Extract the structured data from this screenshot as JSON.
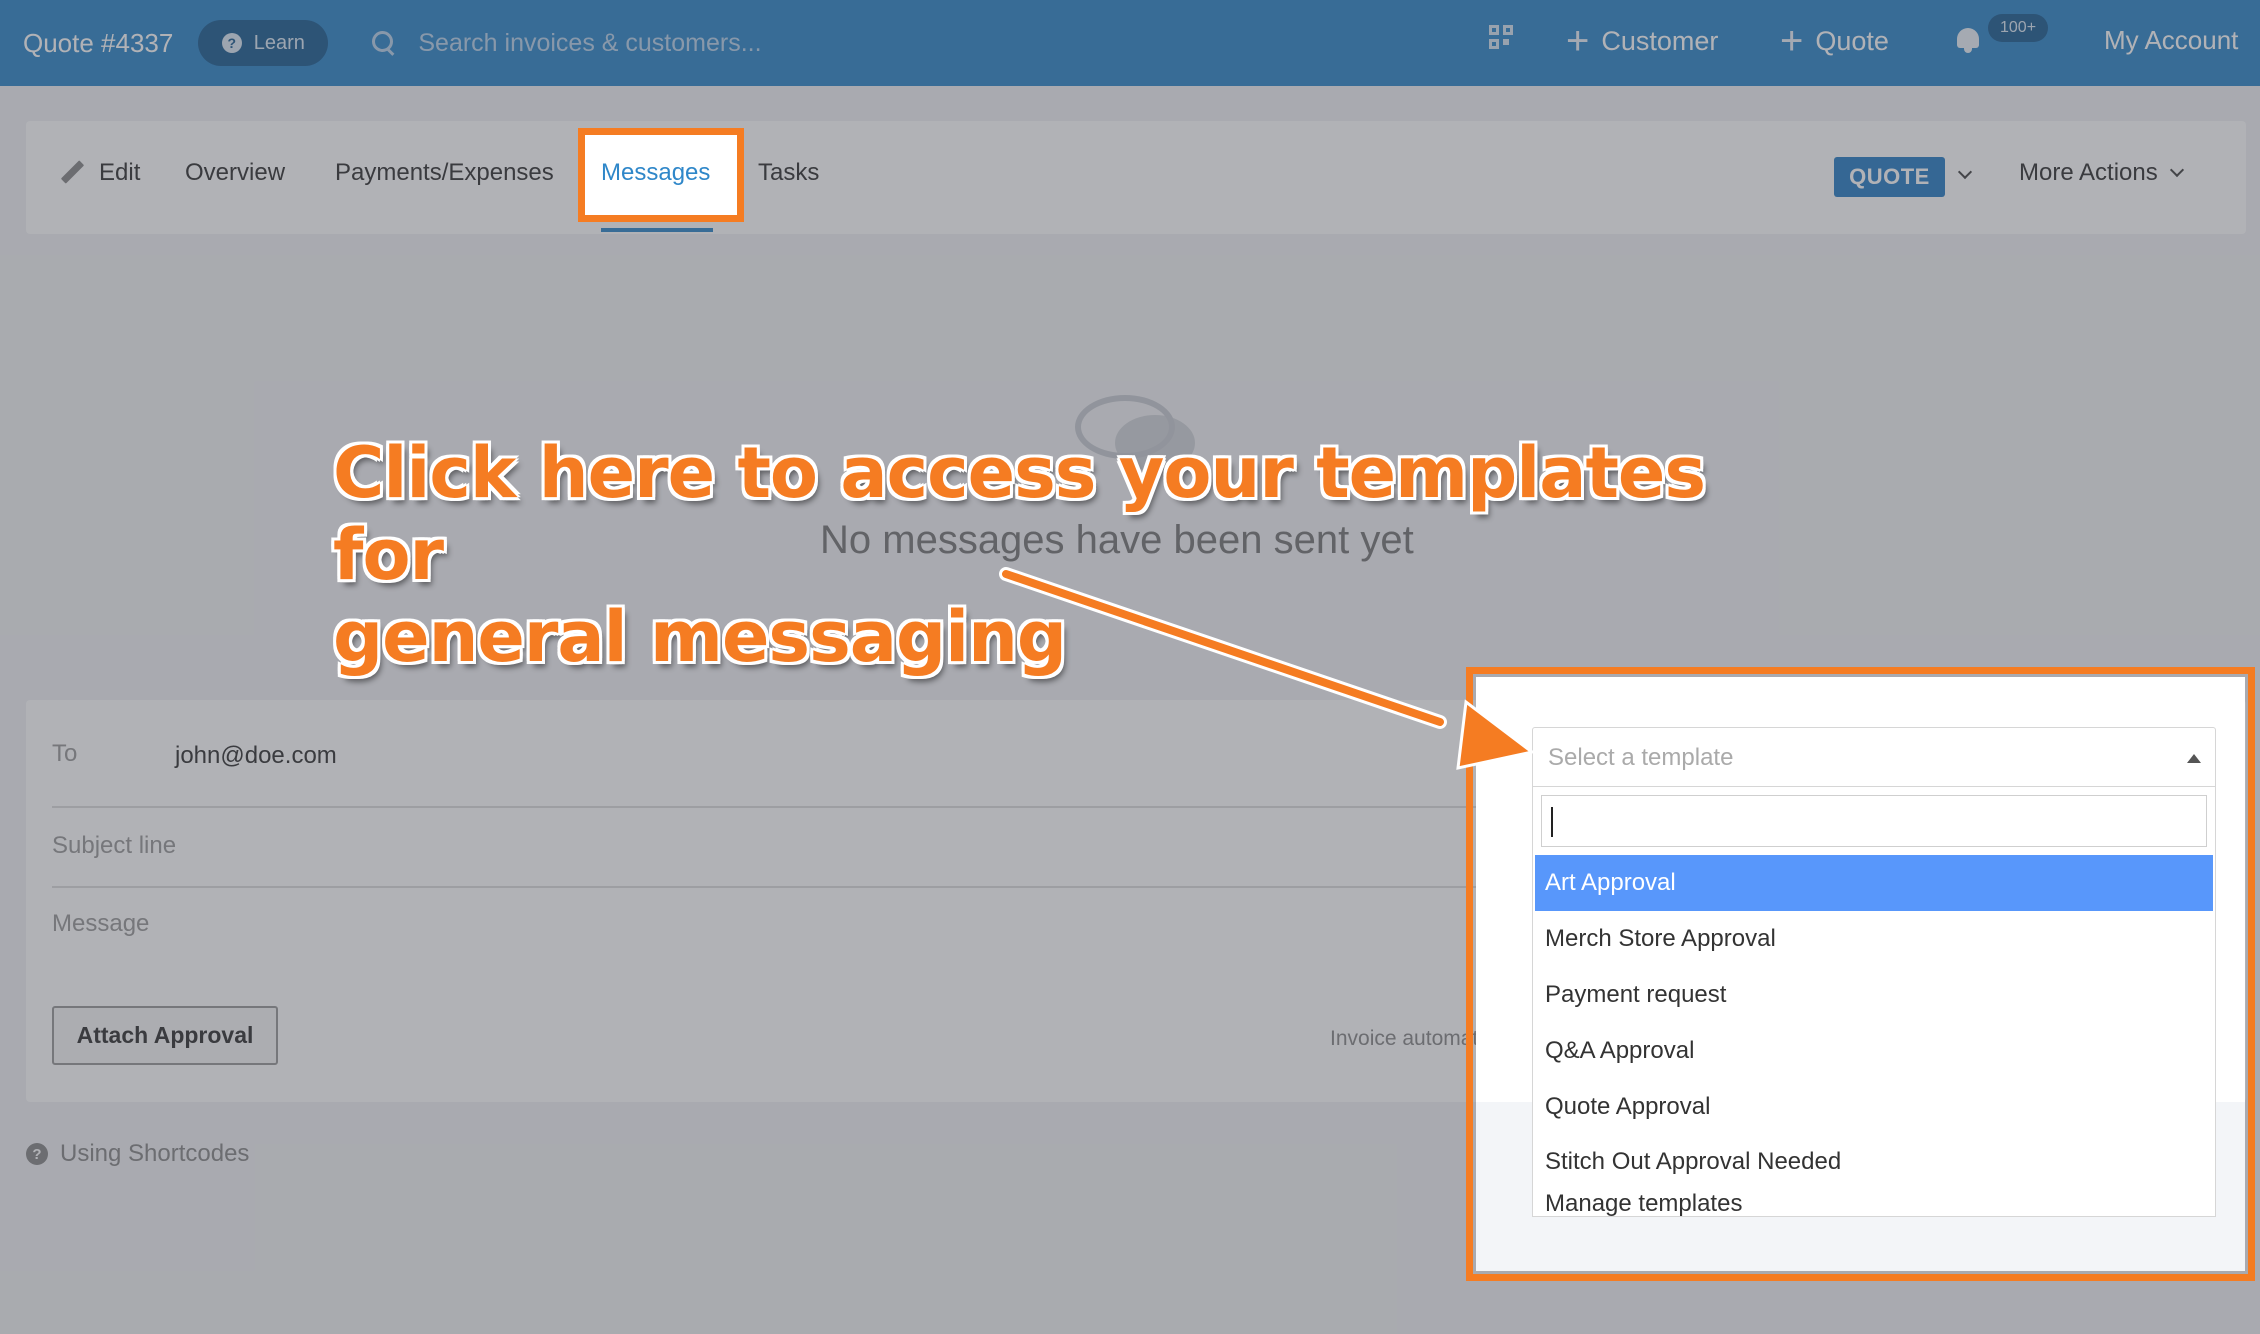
{
  "topbar": {
    "title": "Quote #4337",
    "learn_label": "Learn",
    "search_placeholder": "Search invoices & customers...",
    "customer_label": "Customer",
    "quote_label": "Quote",
    "notifications_badge": "100+",
    "account_label": "My Account"
  },
  "tabs": {
    "edit": "Edit",
    "overview": "Overview",
    "payments": "Payments/Expenses",
    "messages": "Messages",
    "tasks": "Tasks",
    "status_badge": "QUOTE",
    "more_actions": "More Actions"
  },
  "empty_state": {
    "text": "No messages have been sent yet"
  },
  "compose": {
    "to_label": "To",
    "to_value": "john@doe.com",
    "subject_placeholder": "Subject line",
    "message_placeholder": "Message",
    "attach_button": "Attach Approval",
    "auto_note": "Invoice automatically"
  },
  "shortcodes_link": "Using Shortcodes",
  "template_select": {
    "placeholder": "Select a template",
    "search_value": "",
    "options": [
      "Art Approval",
      "Merch Store Approval",
      "Payment request",
      "Q&A Approval",
      "Quote Approval",
      "Stitch Out Approval Needed"
    ],
    "manage_label": "Manage templates",
    "active_index": 0
  },
  "annotation": {
    "callout": "Click here to access your templates for\ngeneral messaging",
    "highlight_color": "#f57c22"
  },
  "colors": {
    "brand_blue": "#2f87c9",
    "selected_option": "#5897fb"
  }
}
